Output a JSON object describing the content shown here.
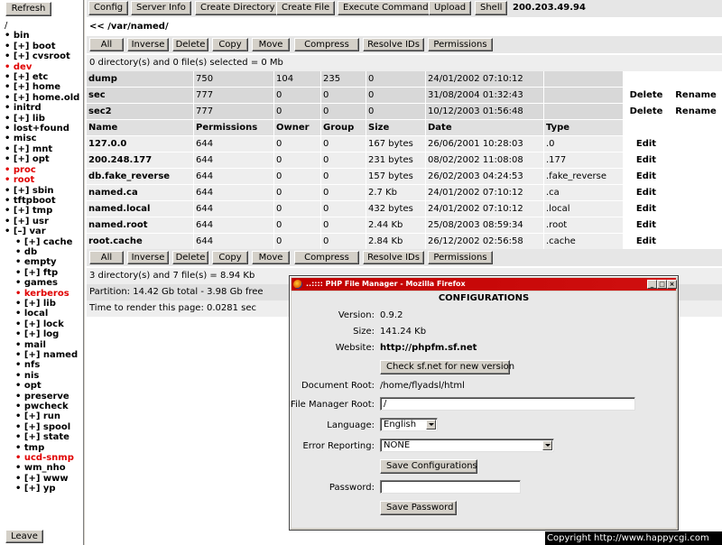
{
  "left_panel": {
    "refresh_label": "Refresh",
    "leave_label": "Leave",
    "root": "/",
    "tree": [
      {
        "label": "• bin",
        "indent": 0,
        "red": false
      },
      {
        "label": "• [+] boot",
        "indent": 0,
        "red": false
      },
      {
        "label": "• [+] cvsroot",
        "indent": 0,
        "red": false
      },
      {
        "label": "• dev",
        "indent": 0,
        "red": true
      },
      {
        "label": "• [+] etc",
        "indent": 0,
        "red": false
      },
      {
        "label": "• [+] home",
        "indent": 0,
        "red": false
      },
      {
        "label": "• [+] home.old",
        "indent": 0,
        "red": false
      },
      {
        "label": "• initrd",
        "indent": 0,
        "red": false
      },
      {
        "label": "• [+] lib",
        "indent": 0,
        "red": false
      },
      {
        "label": "• lost+found",
        "indent": 0,
        "red": false
      },
      {
        "label": "• misc",
        "indent": 0,
        "red": false
      },
      {
        "label": "• [+] mnt",
        "indent": 0,
        "red": false
      },
      {
        "label": "• [+] opt",
        "indent": 0,
        "red": false
      },
      {
        "label": "• proc",
        "indent": 0,
        "red": true
      },
      {
        "label": "• root",
        "indent": 0,
        "red": true
      },
      {
        "label": "• [+] sbin",
        "indent": 0,
        "red": false
      },
      {
        "label": "• tftpboot",
        "indent": 0,
        "red": false
      },
      {
        "label": "• [+] tmp",
        "indent": 0,
        "red": false
      },
      {
        "label": "• [+] usr",
        "indent": 0,
        "red": false
      },
      {
        "label": "• [–] var",
        "indent": 0,
        "red": false
      },
      {
        "label": "• [+] cache",
        "indent": 1,
        "red": false
      },
      {
        "label": "• db",
        "indent": 1,
        "red": false
      },
      {
        "label": "• empty",
        "indent": 1,
        "red": false
      },
      {
        "label": "• [+] ftp",
        "indent": 1,
        "red": false
      },
      {
        "label": "• games",
        "indent": 1,
        "red": false
      },
      {
        "label": "• kerberos",
        "indent": 1,
        "red": true
      },
      {
        "label": "• [+] lib",
        "indent": 1,
        "red": false
      },
      {
        "label": "• local",
        "indent": 1,
        "red": false
      },
      {
        "label": "• [+] lock",
        "indent": 1,
        "red": false
      },
      {
        "label": "• [+] log",
        "indent": 1,
        "red": false
      },
      {
        "label": "• mail",
        "indent": 1,
        "red": false
      },
      {
        "label": "• [+] named",
        "indent": 1,
        "red": false
      },
      {
        "label": "• nfs",
        "indent": 1,
        "red": false
      },
      {
        "label": "• nis",
        "indent": 1,
        "red": false
      },
      {
        "label": "• opt",
        "indent": 1,
        "red": false
      },
      {
        "label": "• preserve",
        "indent": 1,
        "red": false
      },
      {
        "label": "• pwcheck",
        "indent": 1,
        "red": false
      },
      {
        "label": "• [+] run",
        "indent": 1,
        "red": false
      },
      {
        "label": "• [+] spool",
        "indent": 1,
        "red": false
      },
      {
        "label": "• [+] state",
        "indent": 1,
        "red": false
      },
      {
        "label": "• tmp",
        "indent": 1,
        "red": false
      },
      {
        "label": "• ucd-snmp",
        "indent": 1,
        "red": true
      },
      {
        "label": "• wm_nho",
        "indent": 1,
        "red": false
      },
      {
        "label": "• [+] www",
        "indent": 1,
        "red": false
      },
      {
        "label": "• [+] yp",
        "indent": 1,
        "red": false
      }
    ]
  },
  "toolbar": {
    "buttons": [
      "Config",
      "Server Info",
      "Create Directory",
      "Create File",
      "Execute Command",
      "Upload",
      "Shell"
    ],
    "ip": "200.203.49.94"
  },
  "path": "<< /var/named/",
  "actions": [
    "All",
    "Inverse",
    "Delete",
    "Copy",
    "Move",
    "Compress",
    "Resolve IDs",
    "Permissions"
  ],
  "selection_status": "0 directory(s) and 0 file(s) selected = 0 Mb",
  "directories": [
    {
      "name": "dump",
      "permissions": "750",
      "owner": "104",
      "group": "235",
      "size": "0",
      "date": "24/01/2002 07:10:12",
      "actions": []
    },
    {
      "name": "sec",
      "permissions": "777",
      "owner": "0",
      "group": "0",
      "size": "0",
      "date": "31/08/2004 01:32:43",
      "actions": [
        "Delete",
        "Rename"
      ]
    },
    {
      "name": "sec2",
      "permissions": "777",
      "owner": "0",
      "group": "0",
      "size": "0",
      "date": "10/12/2003 01:56:48",
      "actions": [
        "Delete",
        "Rename"
      ]
    }
  ],
  "columns": [
    "Name",
    "Permissions",
    "Owner",
    "Group",
    "Size",
    "Date",
    "Type"
  ],
  "files": [
    {
      "name": "127.0.0",
      "permissions": "644",
      "owner": "0",
      "group": "0",
      "size": "167 bytes",
      "date": "26/06/2001 10:28:03",
      "type": ".0",
      "action": "Edit"
    },
    {
      "name": "200.248.177",
      "permissions": "644",
      "owner": "0",
      "group": "0",
      "size": "231 bytes",
      "date": "08/02/2002 11:08:08",
      "type": ".177",
      "action": "Edit"
    },
    {
      "name": "db.fake_reverse",
      "permissions": "644",
      "owner": "0",
      "group": "0",
      "size": "157 bytes",
      "date": "26/02/2003 04:24:53",
      "type": ".fake_reverse",
      "action": "Edit"
    },
    {
      "name": "named.ca",
      "permissions": "644",
      "owner": "0",
      "group": "0",
      "size": "2.7 Kb",
      "date": "24/01/2002 07:10:12",
      "type": ".ca",
      "action": "Edit"
    },
    {
      "name": "named.local",
      "permissions": "644",
      "owner": "0",
      "group": "0",
      "size": "432 bytes",
      "date": "24/01/2002 07:10:12",
      "type": ".local",
      "action": "Edit"
    },
    {
      "name": "named.root",
      "permissions": "644",
      "owner": "0",
      "group": "0",
      "size": "2.44 Kb",
      "date": "25/08/2003 08:59:34",
      "type": ".root",
      "action": "Edit"
    },
    {
      "name": "root.cache",
      "permissions": "644",
      "owner": "0",
      "group": "0",
      "size": "2.84 Kb",
      "date": "26/12/2002 02:56:58",
      "type": ".cache",
      "action": "Edit"
    }
  ],
  "summary": "3 directory(s) and 7 file(s) = 8.94 Kb",
  "partition": "Partition: 14.42 Gb total - 3.98 Gb free",
  "render_time": "Time to render this page: 0.0281 sec",
  "popup": {
    "window_title": "..:::: PHP File Manager - Mozilla Firefox",
    "heading": "CONFIGURATIONS",
    "version_label": "Version:",
    "version": "0.9.2",
    "size_label": "Size:",
    "size": "141.24 Kb",
    "website_label": "Website:",
    "website": "http://phpfm.sf.net",
    "check_button": "Check sf.net for new version",
    "doc_root_label": "Document Root:",
    "doc_root": "/home/flyadsl/html",
    "fm_root_label": "File Manager Root:",
    "fm_root": "/",
    "language_label": "Language:",
    "language": "English",
    "error_label": "Error Reporting:",
    "error_reporting": "NONE",
    "save_config_button": "Save Configurations",
    "password_label": "Password:",
    "password": "",
    "save_password_button": "Save Password"
  },
  "copyright": "Copyright   http://www.happycgi.com"
}
